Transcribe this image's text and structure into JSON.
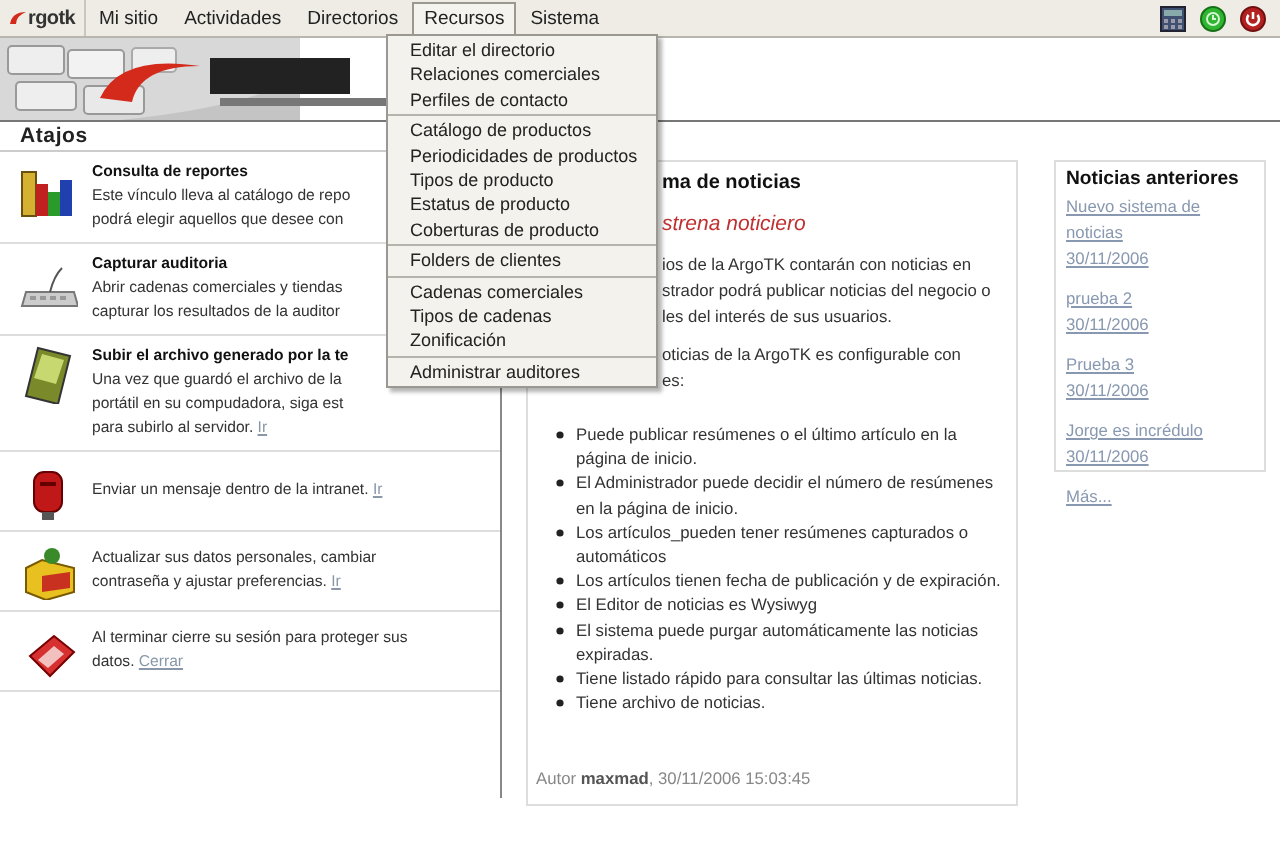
{
  "menubar": {
    "logo": "rgotk",
    "items": [
      {
        "label": "Mi sitio",
        "selected": false
      },
      {
        "label": "Actividades",
        "selected": false
      },
      {
        "label": "Directorios",
        "selected": false
      },
      {
        "label": "Recursos",
        "selected": true
      },
      {
        "label": "Sistema",
        "selected": false
      }
    ]
  },
  "dropdown": {
    "groups": [
      [
        "Editar el directorio",
        "Relaciones comerciales",
        "Perfiles de contacto"
      ],
      [
        "Catálogo de productos",
        "Periodicidades de productos",
        "Tipos de producto",
        "Estatus de producto",
        "Coberturas de producto"
      ],
      [
        "Folders de clientes"
      ],
      [
        "Cadenas comerciales",
        "Tipos de cadenas",
        "Zonificación"
      ],
      [
        "Administrar auditores"
      ]
    ]
  },
  "shortcuts": {
    "title": "Atajos",
    "items": [
      {
        "kind": "chart",
        "title": "Consulta de reportes",
        "lines": [
          "Este vínculo lleva al catálogo de repo",
          "podrá elegir aquellos que desee con"
        ]
      },
      {
        "kind": "keyboard",
        "title": "Capturar auditoria",
        "lines": [
          "Abrir cadenas comerciales y tiendas",
          "capturar los resultados de la auditor"
        ]
      },
      {
        "kind": "handheld",
        "title": "Subir el archivo generado por la te",
        "lines": [
          "Una vez que guardó el archivo de la",
          "portátil en su compudadora, siga est",
          "para subirlo al servidor."
        ],
        "link": "Ir"
      },
      {
        "kind": "mailbox",
        "lines": [
          "Enviar un mensaje dentro de la intranet."
        ],
        "link": "Ir"
      },
      {
        "kind": "folder",
        "lines": [
          "Actualizar sus datos personales, cambiar",
          "contraseña y ajustar preferencias."
        ],
        "link": "Ir"
      },
      {
        "kind": "switch",
        "lines": [
          "Al terminar cierre su sesión para proteger sus",
          "datos."
        ],
        "link": "Cerrar"
      }
    ]
  },
  "article": {
    "title": "ma de noticias",
    "subtitle": "strena noticiero",
    "paragraphs": [
      [
        "ios de la ArgoTK contarán con noticias en",
        "strador podrá publicar noticias del negocio o",
        "les del interés de sus usuarios."
      ],
      [
        "oticias de la ArgoTK es configurable con",
        "es:"
      ]
    ],
    "bullets": [
      "Puede publicar resúmenes o el último artículo en la página de inicio.",
      "El Administrador puede decidir el número de resúmenes en la página de inicio.",
      "Los artículos_pueden tener resúmenes capturados o automáticos",
      "Los artículos tienen fecha de publicación y de expiración.",
      "El Editor de noticias es Wysiwyg",
      "El sistema puede purgar automáticamente las noticias expiradas.",
      "Tiene listado rápido para consultar las últimas noticias.",
      "Tiene archivo de noticias."
    ],
    "footer": "Autor **maxmad**, 30/11/2006 15:03:45"
  },
  "previous_news": {
    "title": "Noticias anteriores",
    "items": [
      {
        "title": "Nuevo sistema de noticias",
        "date": "30/11/2006"
      },
      {
        "title": "prueba 2",
        "date": "30/11/2006"
      },
      {
        "title": "Prueba 3",
        "date": "30/11/2006"
      },
      {
        "title": "Jorge es incrédulo",
        "date": "30/11/2006"
      }
    ],
    "more": "Más..."
  }
}
